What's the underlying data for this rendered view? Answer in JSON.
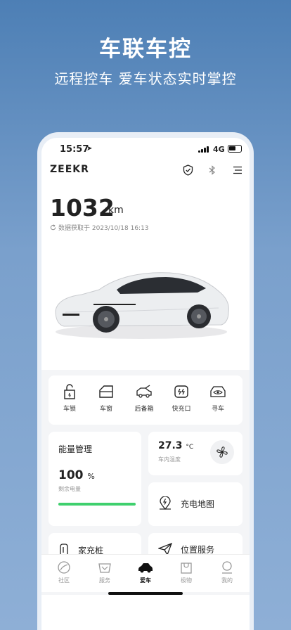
{
  "promo": {
    "title": "车联车控",
    "subtitle": "远程控车  爱车状态实时掌控"
  },
  "status_bar": {
    "time": "15:57",
    "network": "4G"
  },
  "header": {
    "brand": "ZEEKR",
    "icons": [
      "shield-check-icon",
      "bluetooth-icon",
      "menu-icon"
    ]
  },
  "vehicle": {
    "range_value": "1032",
    "range_unit": "km",
    "data_time": "数据获取于 2023/10/18 16:13"
  },
  "quick_controls": [
    {
      "label": "车锁",
      "icon": "lock-icon"
    },
    {
      "label": "车窗",
      "icon": "window-icon"
    },
    {
      "label": "后备箱",
      "icon": "trunk-icon"
    },
    {
      "label": "快充口",
      "icon": "charge-port-icon"
    },
    {
      "label": "寻车",
      "icon": "find-car-icon"
    }
  ],
  "energy": {
    "title": "能量管理",
    "percent": "100",
    "percent_unit": "%",
    "subtitle": "剩余电量",
    "level_fraction": 1.0,
    "bar_color": "#3fd06d"
  },
  "climate": {
    "temp": "27.3",
    "unit": "°C",
    "subtitle": "车内温度"
  },
  "services": {
    "charge_map": "充电地图",
    "home_charger": "家充桩",
    "location": "位置服务"
  },
  "tabbar": [
    {
      "label": "社区",
      "icon": "community-icon",
      "active": false
    },
    {
      "label": "服务",
      "icon": "service-icon",
      "active": false
    },
    {
      "label": "爱车",
      "icon": "car-icon",
      "active": true
    },
    {
      "label": "极物",
      "icon": "shop-icon",
      "active": false
    },
    {
      "label": "我的",
      "icon": "profile-icon",
      "active": false
    }
  ]
}
